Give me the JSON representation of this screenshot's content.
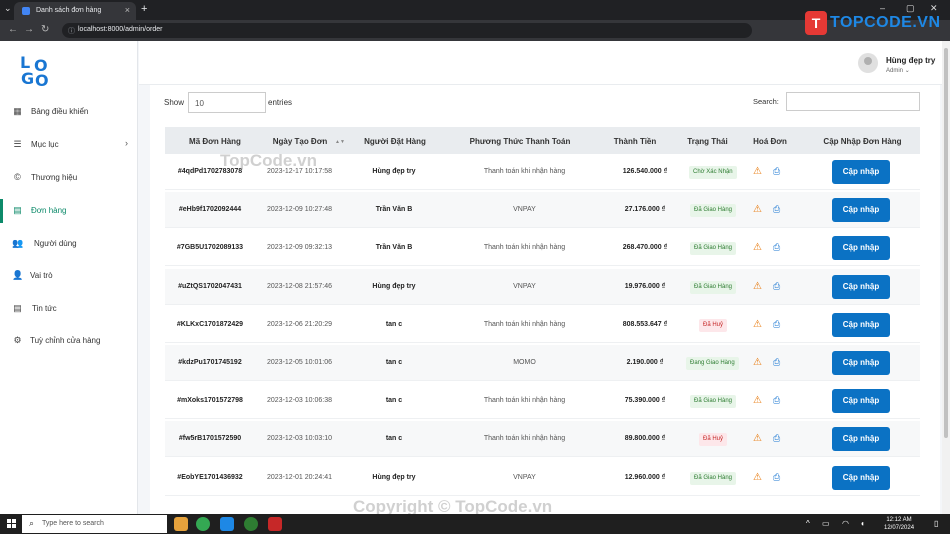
{
  "browser": {
    "tab_title": "Danh sách đơn hàng",
    "url": "localhost:8000/admin/order"
  },
  "brand": {
    "watermark_logo": "TOPCODE.VN",
    "watermark_logo_mark": "T"
  },
  "logo": {
    "l1": "L",
    "l2": "O",
    "l3": "G",
    "l4": "O"
  },
  "sidebar": {
    "items": [
      {
        "label": "Bảng điều khiển",
        "icon": "dashboard-icon"
      },
      {
        "label": "Mục lục",
        "icon": "sliders-icon"
      },
      {
        "label": "Thương hiệu",
        "icon": "brand-icon"
      },
      {
        "label": "Đơn hàng",
        "icon": "orders-icon"
      },
      {
        "label": "Người dùng",
        "icon": "users-icon"
      },
      {
        "label": "Vai trò",
        "icon": "user-icon"
      },
      {
        "label": "Tin tức",
        "icon": "news-icon"
      },
      {
        "label": "Tuỳ chỉnh cửa hàng",
        "icon": "gear-icon"
      }
    ]
  },
  "header": {
    "user_name": "Hùng đẹp try",
    "user_role": "Admin"
  },
  "table_controls": {
    "show_label": "Show",
    "show_value": "10",
    "entries_label": "entries",
    "search_label": "Search:"
  },
  "columns": [
    "Mã Đơn Hàng",
    "Ngày Tạo Đơn",
    "Người Đặt Hàng",
    "Phương Thức Thanh Toán",
    "Thành Tiền",
    "Trạng Thái",
    "Hoá Đơn",
    "Cập Nhập Đơn Hàng"
  ],
  "rows": [
    {
      "code": "#4qdPd1702783078",
      "date": "2023-12-17 10:17:58",
      "user": "Hùng đẹp try",
      "payment": "Thanh toán khi nhận hàng",
      "total": "126.540.000 ₫",
      "status": "Chờ Xác Nhận",
      "status_kind": "pending",
      "action": "Cập nhập"
    },
    {
      "code": "#eHb9f1702092444",
      "date": "2023-12-09 10:27:48",
      "user": "Trần Văn B",
      "payment": "VNPAY",
      "total": "27.176.000 ₫",
      "status": "Đã Giao Hàng",
      "status_kind": "done",
      "action": "Cập nhập"
    },
    {
      "code": "#7GB5U1702089133",
      "date": "2023-12-09 09:32:13",
      "user": "Trần Văn B",
      "payment": "Thanh toán khi nhận hàng",
      "total": "268.470.000 ₫",
      "status": "Đã Giao Hàng",
      "status_kind": "done",
      "action": "Cập nhập"
    },
    {
      "code": "#uZtQS1702047431",
      "date": "2023-12-08 21:57:46",
      "user": "Hùng đẹp try",
      "payment": "VNPAY",
      "total": "19.976.000 ₫",
      "status": "Đã Giao Hàng",
      "status_kind": "done",
      "action": "Cập nhập"
    },
    {
      "code": "#KLKxC1701872429",
      "date": "2023-12-06 21:20:29",
      "user": "tan c",
      "payment": "Thanh toán khi nhận hàng",
      "total": "808.553.647 ₫",
      "status": "Đã Huỷ",
      "status_kind": "cancel",
      "action": "Cập nhập"
    },
    {
      "code": "#kdzPu1701745192",
      "date": "2023-12-05 10:01:06",
      "user": "tan c",
      "payment": "MOMO",
      "total": "2.190.000 ₫",
      "status": "Đang Giao Hàng",
      "status_kind": "ship",
      "action": "Cập nhập"
    },
    {
      "code": "#mXoks1701572798",
      "date": "2023-12-03 10:06:38",
      "user": "tan c",
      "payment": "Thanh toán khi nhận hàng",
      "total": "75.390.000 ₫",
      "status": "Đã Giao Hàng",
      "status_kind": "done",
      "action": "Cập nhập"
    },
    {
      "code": "#fw5rB1701572590",
      "date": "2023-12-03 10:03:10",
      "user": "tan c",
      "payment": "Thanh toán khi nhận hàng",
      "total": "89.800.000 ₫",
      "status": "Đã Huỷ",
      "status_kind": "cancel",
      "action": "Cập nhập"
    },
    {
      "code": "#EobYE1701436932",
      "date": "2023-12-01 20:24:41",
      "user": "Hùng đẹp try",
      "payment": "VNPAY",
      "total": "12.960.000 ₫",
      "status": "Đã Giao Hàng",
      "status_kind": "done",
      "action": "Cập nhập"
    }
  ],
  "watermarks": {
    "mid": "TopCode.vn",
    "bottom": "Copyright © TopCode.vn"
  },
  "taskbar": {
    "search_placeholder": "Type here to search",
    "time": "12:12 AM",
    "date": "12/07/2024"
  },
  "colors": {
    "accent": "#0d8a6a",
    "button": "#0b72c4"
  }
}
